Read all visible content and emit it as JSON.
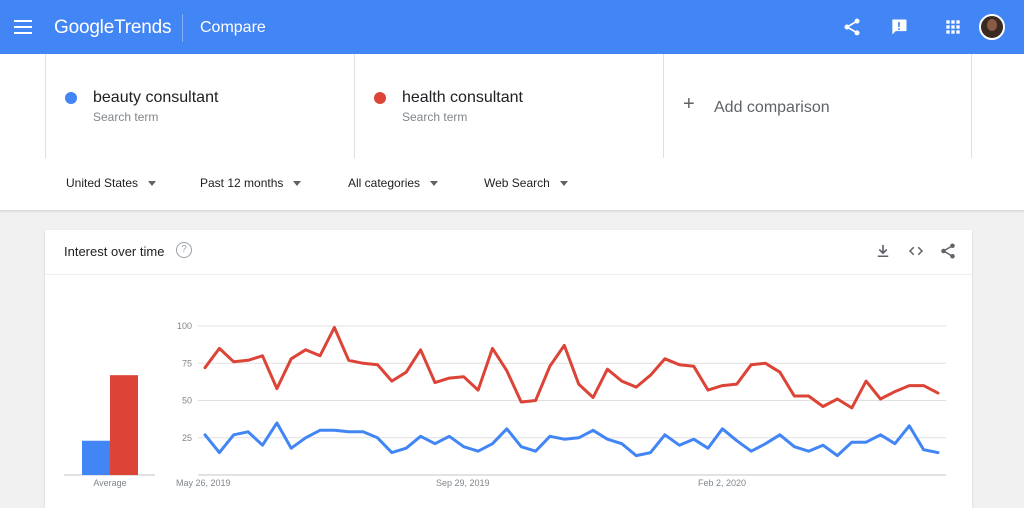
{
  "header": {
    "logo_google": "Google",
    "logo_trends": "Trends",
    "section": "Compare",
    "icons": [
      "menu-icon",
      "share-icon",
      "feedback-icon",
      "apps-grid-icon",
      "avatar"
    ]
  },
  "terms": [
    {
      "name": "beauty consultant",
      "sub": "Search term",
      "color": "#4285f4"
    },
    {
      "name": "health consultant",
      "sub": "Search term",
      "color": "#db4437"
    }
  ],
  "add_comparison": "Add comparison",
  "filters": [
    "United States",
    "Past 12 months",
    "All categories",
    "Web Search"
  ],
  "card": {
    "title": "Interest over time",
    "help": "?",
    "icons": [
      "download-icon",
      "embed-icon",
      "share-icon"
    ]
  },
  "chart_data": {
    "type": "line",
    "y_ticks": [
      "100",
      "75",
      "50",
      "25"
    ],
    "ylim": [
      0,
      100
    ],
    "x_tick_labels": [
      "May 26, 2019",
      "Sep 29, 2019",
      "Feb 2, 2020"
    ],
    "average_label": "Average",
    "averages": [
      23,
      67
    ],
    "series": [
      {
        "name": "beauty consultant",
        "color": "#4285f4",
        "values": [
          27,
          15,
          27,
          29,
          20,
          35,
          18,
          25,
          30,
          30,
          29,
          29,
          25,
          15,
          18,
          26,
          21,
          26,
          19,
          16,
          21,
          31,
          19,
          16,
          26,
          24,
          25,
          30,
          24,
          21,
          13,
          15,
          27,
          20,
          24,
          18,
          31,
          23,
          16,
          21,
          27,
          19,
          16,
          20,
          13,
          22,
          22,
          27,
          21,
          33,
          17,
          15
        ]
      },
      {
        "name": "health consultant",
        "color": "#db4437",
        "values": [
          72,
          85,
          76,
          77,
          80,
          58,
          78,
          84,
          80,
          99,
          77,
          75,
          74,
          63,
          69,
          84,
          62,
          65,
          66,
          57,
          85,
          70,
          49,
          50,
          73,
          87,
          61,
          52,
          71,
          63,
          59,
          67,
          78,
          74,
          73,
          57,
          60,
          61,
          74,
          75,
          69,
          53,
          53,
          46,
          51,
          45,
          63,
          51,
          56,
          60,
          60,
          55
        ]
      }
    ]
  }
}
